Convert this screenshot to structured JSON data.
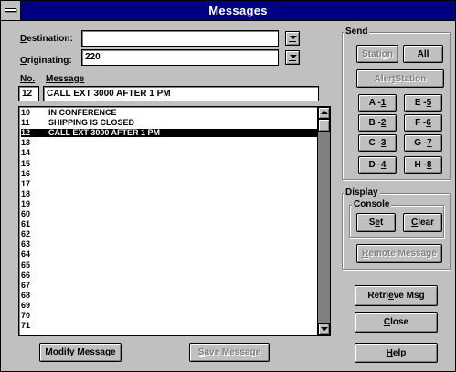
{
  "window": {
    "title": "Messages"
  },
  "destination": {
    "label_first": "D",
    "label_rest": "estination:",
    "value": ""
  },
  "originating": {
    "label_first": "O",
    "label_rest": "riginating:",
    "value": "220"
  },
  "columns": {
    "no_label": "No.",
    "message_label": "Message"
  },
  "current": {
    "no": "12",
    "message": "CALL EXT 3000 AFTER 1 PM"
  },
  "messages": [
    {
      "no": "10",
      "text": "IN CONFERENCE"
    },
    {
      "no": "11",
      "text": "SHIPPING IS CLOSED"
    },
    {
      "no": "12",
      "text": "CALL EXT 3000 AFTER 1 PM",
      "selected": true
    },
    {
      "no": "13",
      "text": ""
    },
    {
      "no": "14",
      "text": ""
    },
    {
      "no": "15",
      "text": ""
    },
    {
      "no": "16",
      "text": ""
    },
    {
      "no": "17",
      "text": ""
    },
    {
      "no": "18",
      "text": ""
    },
    {
      "no": "19",
      "text": ""
    },
    {
      "no": "60",
      "text": ""
    },
    {
      "no": "61",
      "text": ""
    },
    {
      "no": "62",
      "text": ""
    },
    {
      "no": "63",
      "text": ""
    },
    {
      "no": "64",
      "text": ""
    },
    {
      "no": "65",
      "text": ""
    },
    {
      "no": "66",
      "text": ""
    },
    {
      "no": "67",
      "text": ""
    },
    {
      "no": "68",
      "text": ""
    },
    {
      "no": "69",
      "text": ""
    },
    {
      "no": "70",
      "text": ""
    },
    {
      "no": "71",
      "text": ""
    }
  ],
  "send": {
    "title": "Send",
    "station": {
      "pre": "Stati",
      "u": "o",
      "post": "n"
    },
    "all": {
      "pre": "",
      "u": "A",
      "post": "ll"
    },
    "alert_station": {
      "pre": "Aler",
      "u": "t",
      "post": " Station"
    },
    "keys": [
      {
        "pre": "A - ",
        "u": "1"
      },
      {
        "pre": "E - ",
        "u": "5"
      },
      {
        "pre": "B - ",
        "u": "2"
      },
      {
        "pre": "F - ",
        "u": "6"
      },
      {
        "pre": "C - ",
        "u": "3"
      },
      {
        "pre": "G - ",
        "u": "7"
      },
      {
        "pre": "D - ",
        "u": "4"
      },
      {
        "pre": "H - ",
        "u": "8"
      }
    ]
  },
  "display": {
    "title": "Display",
    "console_title": "Console",
    "set": {
      "pre": "S",
      "u": "e",
      "post": "t"
    },
    "clear": {
      "pre": "",
      "u": "C",
      "post": "lear"
    },
    "remote_message": {
      "pre": "",
      "u": "R",
      "post": "emote Message"
    }
  },
  "buttons": {
    "retrieve": {
      "pre": "Retri",
      "u": "e",
      "post": "ve Msg"
    },
    "close": {
      "pre": "",
      "u": "C",
      "post": "lose"
    },
    "modify": {
      "pre": "Modif",
      "u": "y",
      "post": " Message"
    },
    "save": {
      "pre": "",
      "u": "S",
      "post": "ave Message"
    },
    "help": {
      "pre": "",
      "u": "H",
      "post": "elp"
    }
  }
}
